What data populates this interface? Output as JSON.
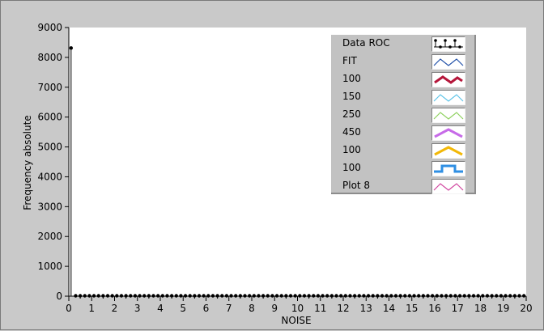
{
  "chart_data": {
    "type": "line",
    "xlabel": "NOISE",
    "ylabel": "Frequency absolute",
    "xlim": [
      0,
      20
    ],
    "ylim": [
      0,
      9000
    ],
    "x_ticks": [
      "0",
      "1",
      "2",
      "3",
      "4",
      "5",
      "6",
      "7",
      "8",
      "9",
      "10",
      "11",
      "12",
      "13",
      "14",
      "15",
      "16",
      "17",
      "18",
      "19",
      "20"
    ],
    "y_ticks": [
      "0",
      "1000",
      "2000",
      "3000",
      "4000",
      "5000",
      "6000",
      "7000",
      "8000",
      "9000"
    ],
    "grid": false,
    "legend_position": "top-right",
    "series": [
      {
        "name": "Data ROC",
        "color": "#000000",
        "style": "stem",
        "points": [
          [
            0.1,
            8300
          ],
          [
            0.3,
            0
          ],
          [
            0.5,
            0
          ],
          [
            0.7,
            0
          ],
          [
            0.9,
            0
          ],
          [
            1.1,
            0
          ],
          [
            1.3,
            0
          ],
          [
            1.5,
            0
          ],
          [
            1.7,
            0
          ],
          [
            1.9,
            0
          ],
          [
            2.1,
            0
          ],
          [
            2.3,
            0
          ],
          [
            2.5,
            0
          ],
          [
            2.7,
            0
          ],
          [
            2.9,
            0
          ],
          [
            3.1,
            0
          ],
          [
            3.3,
            0
          ],
          [
            3.5,
            0
          ],
          [
            3.7,
            0
          ],
          [
            3.9,
            0
          ],
          [
            4.1,
            0
          ],
          [
            4.3,
            0
          ],
          [
            4.5,
            0
          ],
          [
            4.7,
            0
          ],
          [
            4.9,
            0
          ],
          [
            5.1,
            0
          ],
          [
            5.3,
            0
          ],
          [
            5.5,
            0
          ],
          [
            5.7,
            0
          ],
          [
            5.9,
            0
          ],
          [
            6.1,
            0
          ],
          [
            6.3,
            0
          ],
          [
            6.5,
            0
          ],
          [
            6.7,
            0
          ],
          [
            6.9,
            0
          ],
          [
            7.1,
            0
          ],
          [
            7.3,
            0
          ],
          [
            7.5,
            0
          ],
          [
            7.7,
            0
          ],
          [
            7.9,
            0
          ],
          [
            8.1,
            0
          ],
          [
            8.3,
            0
          ],
          [
            8.5,
            0
          ],
          [
            8.7,
            0
          ],
          [
            8.9,
            0
          ],
          [
            9.1,
            0
          ],
          [
            9.3,
            0
          ],
          [
            9.5,
            0
          ],
          [
            9.7,
            0
          ],
          [
            9.9,
            0
          ],
          [
            10.1,
            0
          ],
          [
            10.3,
            0
          ],
          [
            10.5,
            0
          ],
          [
            10.7,
            0
          ],
          [
            10.9,
            0
          ],
          [
            11.1,
            0
          ],
          [
            11.3,
            0
          ],
          [
            11.5,
            0
          ],
          [
            11.7,
            0
          ],
          [
            11.9,
            0
          ],
          [
            12.1,
            0
          ],
          [
            12.3,
            0
          ],
          [
            12.5,
            0
          ],
          [
            12.7,
            0
          ],
          [
            12.9,
            0
          ],
          [
            13.1,
            0
          ],
          [
            13.3,
            0
          ],
          [
            13.5,
            0
          ],
          [
            13.7,
            0
          ],
          [
            13.9,
            0
          ],
          [
            14.1,
            0
          ],
          [
            14.3,
            0
          ],
          [
            14.5,
            0
          ],
          [
            14.7,
            0
          ],
          [
            14.9,
            0
          ],
          [
            15.1,
            0
          ],
          [
            15.3,
            0
          ],
          [
            15.5,
            0
          ],
          [
            15.7,
            0
          ],
          [
            15.9,
            0
          ],
          [
            16.1,
            0
          ],
          [
            16.3,
            0
          ],
          [
            16.5,
            0
          ],
          [
            16.7,
            0
          ],
          [
            16.9,
            0
          ],
          [
            17.1,
            0
          ],
          [
            17.3,
            0
          ],
          [
            17.5,
            0
          ],
          [
            17.7,
            0
          ],
          [
            17.9,
            0
          ],
          [
            18.1,
            0
          ],
          [
            18.3,
            0
          ],
          [
            18.5,
            0
          ],
          [
            18.7,
            0
          ],
          [
            18.9,
            0
          ],
          [
            19.1,
            0
          ],
          [
            19.3,
            0
          ],
          [
            19.5,
            0
          ],
          [
            19.7,
            0
          ],
          [
            19.9,
            0
          ]
        ]
      }
    ],
    "legend": [
      {
        "label": "Data ROC",
        "color": "#000000",
        "swatch": "stem-icon"
      },
      {
        "label": "FIT",
        "color": "#1f4fa8",
        "swatch": "zigzag-icon"
      },
      {
        "label": "100",
        "color": "#b5163a",
        "swatch": "thick-zigzag-icon"
      },
      {
        "label": "150",
        "color": "#5ec4e8",
        "swatch": "zigzag-icon"
      },
      {
        "label": "250",
        "color": "#8ed15e",
        "swatch": "zigzag-icon"
      },
      {
        "label": "450",
        "color": "#c76be8",
        "swatch": "thick-peak-icon"
      },
      {
        "label": "100",
        "color": "#f2b807",
        "swatch": "thick-peak-icon"
      },
      {
        "label": "100",
        "color": "#2f8fe3",
        "swatch": "square-step-icon"
      },
      {
        "label": "Plot 8",
        "color": "#d1459f",
        "swatch": "zigzag-icon"
      }
    ]
  }
}
